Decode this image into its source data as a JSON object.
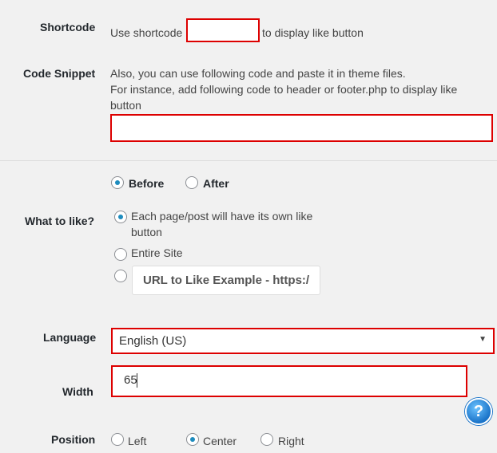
{
  "shortcode": {
    "label": "Shortcode",
    "text_before": "Use shortcode",
    "text_after": "to display like button",
    "value": ""
  },
  "code_snippet": {
    "label": "Code Snippet",
    "line1": "Also, you can use following code and paste it in theme files.",
    "line2": "For instance, add following code to header or footer.php to display like",
    "line3": "button",
    "value": ""
  },
  "placement": {
    "options": [
      "Before",
      "After"
    ],
    "selected": "Before"
  },
  "what_to_like": {
    "label": "What to like?",
    "option_each_line1": "Each page/post will have its own like",
    "option_each_line2": "button",
    "option_site": "Entire Site",
    "url_placeholder": "URL to Like Example - https:/",
    "selected": "each"
  },
  "language": {
    "label": "Language",
    "value": "English (US)",
    "arrow": "▼"
  },
  "width": {
    "label": "Width",
    "value": "65"
  },
  "help": {
    "icon": "help-icon",
    "glyph": "?"
  },
  "position": {
    "label": "Position",
    "options": [
      "Left",
      "Center",
      "Right"
    ],
    "selected": "Center"
  },
  "colors": {
    "highlight_border": "#dd0000",
    "radio_dot": "#1e8cbe",
    "background": "#f1f1f1"
  }
}
